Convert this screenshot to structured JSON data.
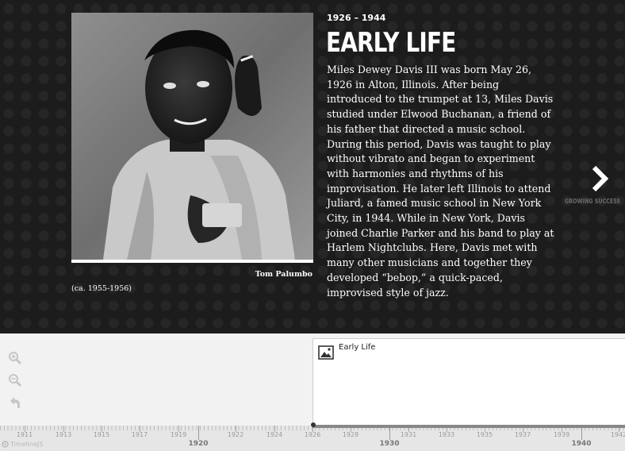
{
  "slide": {
    "dates": "1926 – 1944",
    "headline": "EARLY LIFE",
    "body": "Miles Dewey Davis III was born May 26, 1926 in Alton, Illinois. After being introduced to the trumpet at 13, Miles Davis studied under Elwood Buchanan, a friend of his father that directed a music school. During this period, Davis was taught to play without vibrato and began to experiment with harmonies and rhythms of his improvisation. He later left Illinois to attend Juliard, a famed music school in New York City, in 1944. While in New York, Davis joined Charlie Parker and his band to play at Harlem Nightclubs. Here, Davis met with many other musicians and together they developed “bebop,” a quick-paced, improvised style of jazz.",
    "media_credit": "Tom Palumbo",
    "media_caption": "(ca. 1955-1956)"
  },
  "nav": {
    "next_icon": "chevron-right-icon",
    "next_title": "GROWING SUCCESS"
  },
  "timeline": {
    "tools": [
      "zoom-in-icon",
      "zoom-out-icon",
      "back-to-start-icon"
    ],
    "marker": {
      "title": "Early Life",
      "icon": "image-icon"
    },
    "minor_years": [
      "1911",
      "1913",
      "1915",
      "1917",
      "1919",
      "1922",
      "1924",
      "1926",
      "1928",
      "1931",
      "1933",
      "1935",
      "1937",
      "1939",
      "1942"
    ],
    "major_years": [
      "1920",
      "1930",
      "1940"
    ],
    "brand": "TimelineJS"
  },
  "colors": {
    "stage_bg": "#1c1c1c",
    "timeline_bg": "#f2f2f2",
    "text_light": "#ffffff"
  }
}
